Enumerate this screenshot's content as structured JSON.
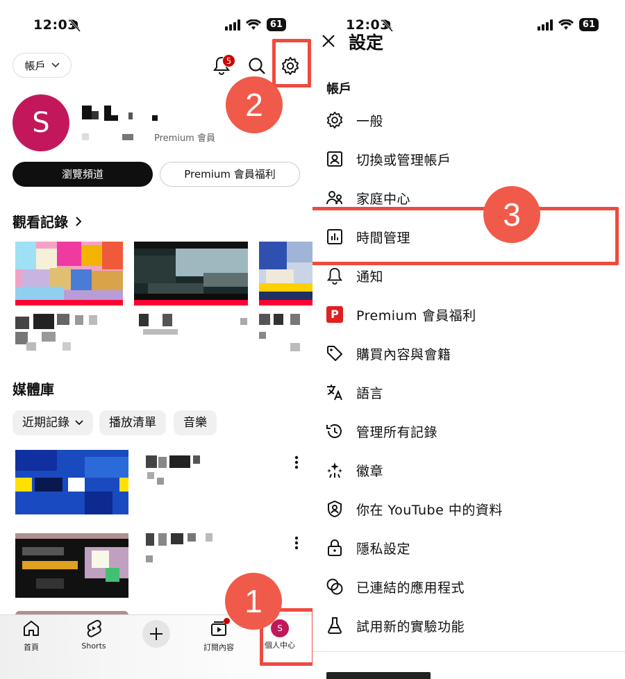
{
  "status_bar": {
    "time": "12:03",
    "battery": "61"
  },
  "left": {
    "account_button": "帳戶",
    "notification_count": "5",
    "profile": {
      "avatar_letter": "S",
      "membership": "Premium 會員"
    },
    "buttons": {
      "view_channel": "瀏覽頻道",
      "premium_benefits": "Premium 會員福利"
    },
    "history_title": "觀看記錄",
    "library_title": "媒體庫",
    "library_chips": [
      "近期記錄",
      "播放清單",
      "音樂"
    ],
    "bottom_nav": [
      {
        "label": "首頁",
        "icon": "home-icon"
      },
      {
        "label": "Shorts",
        "icon": "shorts-icon"
      },
      {
        "label": "",
        "icon": "create-icon"
      },
      {
        "label": "訂閱內容",
        "icon": "subscriptions-icon"
      },
      {
        "label": "個人中心",
        "icon": "profile-icon",
        "avatar_letter": "S"
      }
    ]
  },
  "right": {
    "title": "設定",
    "section": "帳戶",
    "menu": [
      {
        "label": "一般",
        "icon": "gear-icon"
      },
      {
        "label": "切換或管理帳戶",
        "icon": "account-box-icon"
      },
      {
        "label": "家庭中心",
        "icon": "family-icon"
      },
      {
        "label": "時間管理",
        "icon": "bar-chart-icon"
      },
      {
        "label": "通知",
        "icon": "bell-icon"
      },
      {
        "label": "Premium 會員福利",
        "icon": "premium-icon",
        "icon_text": "P"
      },
      {
        "label": "購買內容與會籍",
        "icon": "tag-icon"
      },
      {
        "label": "語言",
        "icon": "translate-icon"
      },
      {
        "label": "管理所有記錄",
        "icon": "history-icon"
      },
      {
        "label": "徽章",
        "icon": "sparkle-icon"
      },
      {
        "label": "你在 YouTube 中的資料",
        "icon": "shield-person-icon"
      },
      {
        "label": "隱私設定",
        "icon": "lock-icon"
      },
      {
        "label": "已連結的應用程式",
        "icon": "linked-apps-icon"
      },
      {
        "label": "試用新的實驗功能",
        "icon": "flask-icon"
      }
    ]
  },
  "annotations": [
    "1",
    "2",
    "3"
  ],
  "colors": {
    "youtube_red": "#ff0000",
    "annotation": "#ef4a3f",
    "avatar": "#c2185b"
  }
}
